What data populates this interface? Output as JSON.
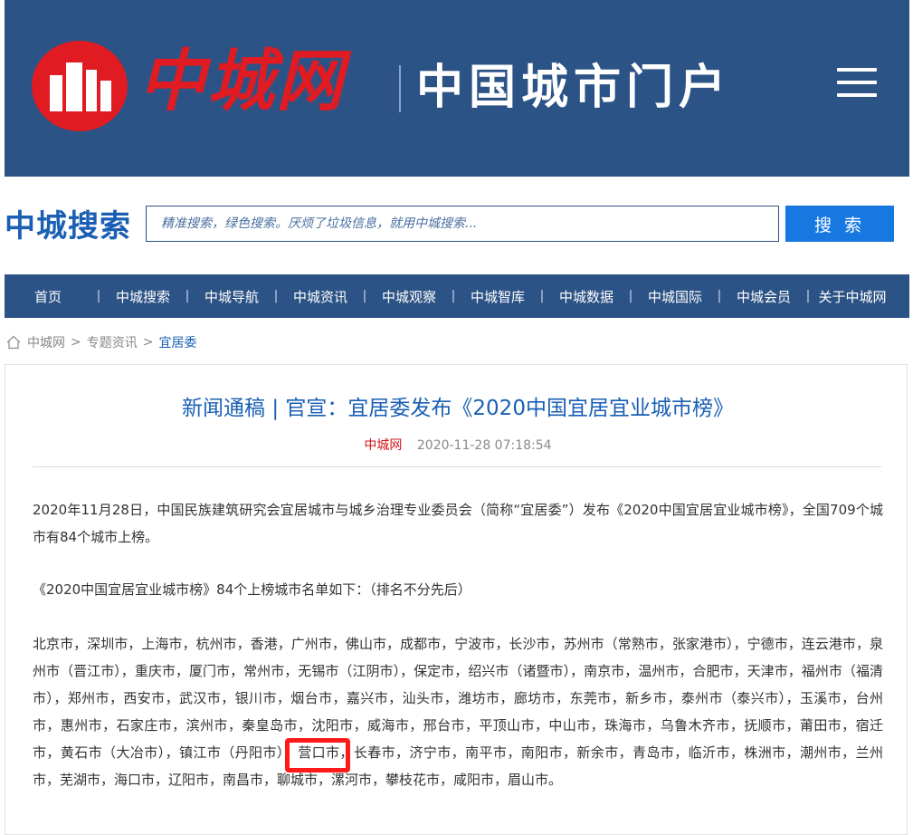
{
  "header": {
    "logo_text": "中城网",
    "slogan": "中国城市门户",
    "menu_icon": "hamburger-menu-icon"
  },
  "search": {
    "brand": "中城搜索",
    "placeholder": "精准搜索，绿色搜索。厌烦了垃圾信息，就用中城搜索...",
    "button_label": "搜 索"
  },
  "nav": {
    "items": [
      "首页",
      "中城搜索",
      "中城导航",
      "中城资讯",
      "中城观察",
      "中城智库",
      "中城数据",
      "中城国际",
      "中城会员",
      "关于中城网"
    ]
  },
  "breadcrumb": {
    "items": [
      "中城网",
      "专题资讯"
    ],
    "current": "宜居委",
    "separator": ">"
  },
  "article": {
    "title": "新闻通稿 | 官宣：宜居委发布《2020中国宜居宜业城市榜》",
    "source": "中城网",
    "time": "2020-11-28 07:18:54",
    "paragraphs": [
      "2020年11月28日，中国民族建筑研究会宜居城市与城乡治理专业委员会（简称“宜居委”）发布《2020中国宜居宜业城市榜》，全国709个城市有84个城市上榜。",
      "《2020中国宜居宜业城市榜》84个上榜城市名单如下：（排名不分先后）",
      "北京市，深圳市，上海市，杭州市，香港，广州市，佛山市，成都市，宁波市，长沙市，苏州市（常熟市，张家港市），宁德市，连云港市，泉州市（晋江市），重庆市，厦门市，常州市，无锡市（江阴市），保定市，绍兴市（诸暨市），南京市，温州市，合肥市，天津市，福州市（福清市），郑州市，西安市，武汉市，银川市，烟台市，嘉兴市，汕头市，潍坊市，廊坊市，东莞市，新乡市，泰州市（泰兴市），玉溪市，台州市，惠州市，石家庄市，滨州市，秦皇岛市，沈阳市，威海市，邢台市，平顶山市，中山市，珠海市，乌鲁木齐市，抚顺市，莆田市，宿迁市，黄石市（大冶市），镇江市（丹阳市），营口市，长春市，济宁市，南平市，南阳市，新余市，青岛市，临沂市，株洲市，潮州市，兰州市，芜湖市，海口市，辽阳市，南昌市，聊城市，漯河市，攀枝花市，咸阳市，眉山市。"
    ]
  },
  "colors": {
    "header_bg": "#2c5386",
    "brand_red": "#e01b22",
    "link_blue": "#1a5fb4",
    "button_blue": "#1678e0",
    "highlight": "#ff1a1a"
  }
}
